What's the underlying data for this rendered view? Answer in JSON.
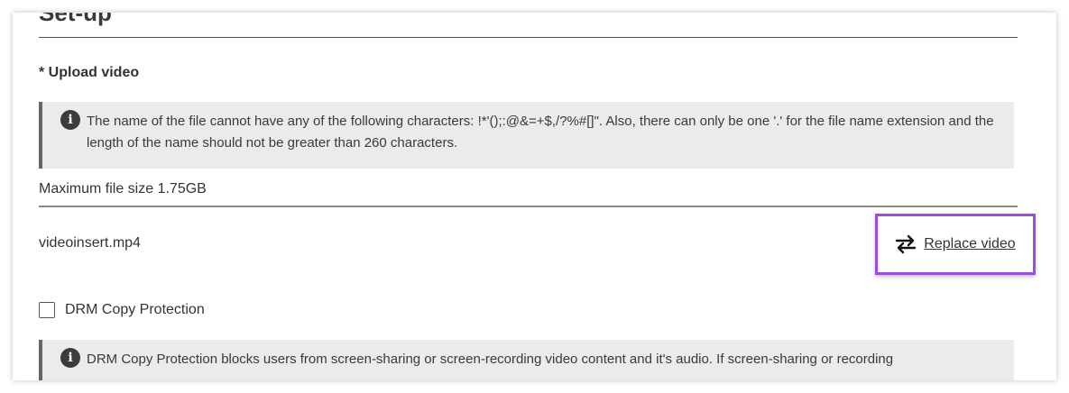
{
  "section": {
    "title": "Set-up"
  },
  "upload": {
    "label": "* Upload video",
    "info": "The name of the file cannot have any of the following characters: !*'();:@&=+$,/?%#[]\". Also, there can only be one '.' for the file name extension and the length of the name should not be greater than 260 characters.",
    "max_size": "Maximum file size 1.75GB",
    "filename": "videoinsert.mp4",
    "replace_label": "Replace video",
    "replace_icon": "swap-arrows-icon",
    "highlight_color": "#9b4ddf"
  },
  "drm": {
    "label": "DRM Copy Protection",
    "checked": false,
    "info": "DRM Copy Protection blocks users from screen-sharing or screen-recording video content and it's audio. If screen-sharing or recording"
  }
}
